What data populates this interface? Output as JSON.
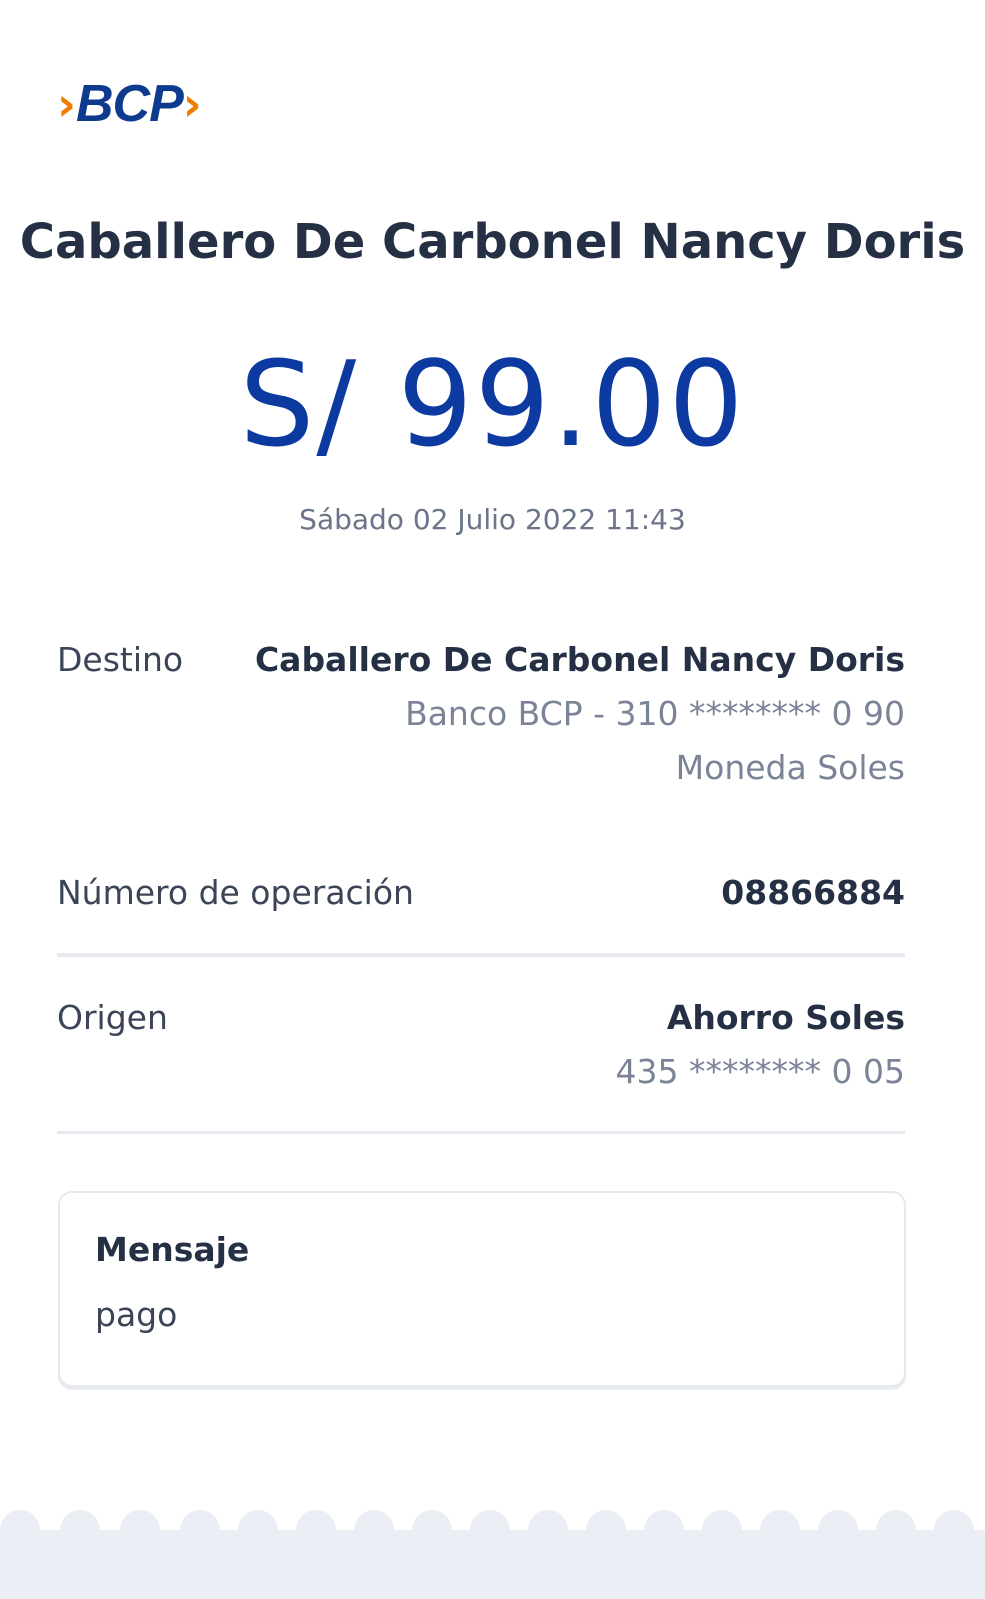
{
  "logo": {
    "text": "BCP"
  },
  "recipient_name": "Caballero De Carbonel Nancy Doris",
  "amount": "S/ 99.00",
  "datetime": "Sábado 02 Julio 2022 11:43",
  "destino": {
    "label": "Destino",
    "name": "Caballero De Carbonel Nancy Doris",
    "account": "Banco BCP - 310 ******** 0 90",
    "currency": "Moneda Soles"
  },
  "operation": {
    "label": "Número de operación",
    "value": "08866884"
  },
  "origen": {
    "label": "Origen",
    "account_type": "Ahorro Soles",
    "account": "435 ******** 0 05"
  },
  "mensaje": {
    "title": "Mensaje",
    "text": "pago"
  },
  "colors": {
    "brand_blue": "#0c3aa1",
    "brand_orange": "#f07d00",
    "text_dark": "#253044",
    "text_muted": "#7b8497"
  }
}
